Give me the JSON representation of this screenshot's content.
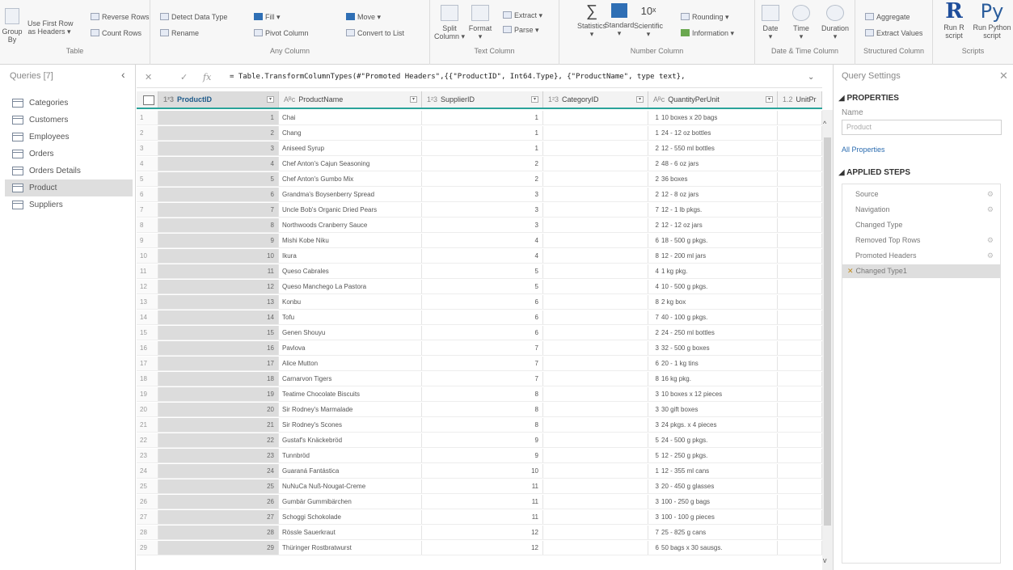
{
  "ribbon": {
    "table": {
      "group_label": "Table",
      "group_by": "Group\nBy",
      "use_first_row": "Use First Row\nas Headers ▾",
      "reverse_rows": "Reverse Rows",
      "count_rows": "Count Rows"
    },
    "any_column": {
      "group_label": "Any Column",
      "detect_data_type": "Detect Data Type",
      "rename": "Rename",
      "fill": "Fill ▾",
      "pivot_column": "Pivot Column",
      "move": "Move ▾",
      "convert_to_list": "Convert to List"
    },
    "text_column": {
      "group_label": "Text Column",
      "split_column": "Split\nColumn ▾",
      "format": "Format\n▾",
      "extract": "Extract ▾",
      "parse": "Parse ▾"
    },
    "number_column": {
      "group_label": "Number Column",
      "statistics": "Statistics\n▾",
      "standard": "Standard\n▾",
      "scientific": "Scientific\n▾",
      "rounding": "Rounding ▾",
      "information": "Information ▾"
    },
    "datetime_column": {
      "group_label": "Date & Time Column",
      "date": "Date\n▾",
      "time": "Time\n▾",
      "duration": "Duration\n▾"
    },
    "structured_column": {
      "group_label": "Structured Column",
      "aggregate": "Aggregate",
      "extract_values": "Extract Values"
    },
    "scripts": {
      "group_label": "Scripts",
      "run_r": "Run R\nscript",
      "run_python": "Run Python\nscript"
    }
  },
  "queries": {
    "header": "Queries [7]",
    "items": [
      "Categories",
      "Customers",
      "Employees",
      "Orders",
      "Orders Details",
      "Product",
      "Suppliers"
    ],
    "active_index": 5
  },
  "formula_bar": {
    "formula": "= Table.TransformColumnTypes(#\"Promoted Headers\",{{\"ProductID\", Int64.Type}, {\"ProductName\", type text},"
  },
  "grid": {
    "columns": [
      {
        "type": "1²3",
        "name": "ProductID"
      },
      {
        "type": "Aᴮc",
        "name": "ProductName"
      },
      {
        "type": "1²3",
        "name": "SupplierID"
      },
      {
        "type": "1²3",
        "name": "CategoryID"
      },
      {
        "type": "Aᴮc",
        "name": "QuantityPerUnit"
      },
      {
        "type": "1.2",
        "name": "UnitPr"
      }
    ],
    "rows": [
      [
        1,
        "Chai",
        1,
        1,
        "10 boxes x 20 bags"
      ],
      [
        2,
        "Chang",
        1,
        1,
        "24 - 12 oz bottles"
      ],
      [
        3,
        "Aniseed Syrup",
        1,
        2,
        "12 - 550 ml bottles"
      ],
      [
        4,
        "Chef Anton's Cajun Seasoning",
        2,
        2,
        "48 - 6 oz jars"
      ],
      [
        5,
        "Chef Anton's Gumbo Mix",
        2,
        2,
        "36 boxes"
      ],
      [
        6,
        "Grandma's Boysenberry Spread",
        3,
        2,
        "12 - 8 oz jars"
      ],
      [
        7,
        "Uncle Bob's Organic Dried Pears",
        3,
        7,
        "12 - 1 lb pkgs."
      ],
      [
        8,
        "Northwoods Cranberry Sauce",
        3,
        2,
        "12 - 12 oz jars"
      ],
      [
        9,
        "Mishi Kobe Niku",
        4,
        6,
        "18 - 500 g pkgs."
      ],
      [
        10,
        "Ikura",
        4,
        8,
        "12 - 200 ml jars"
      ],
      [
        11,
        "Queso Cabrales",
        5,
        4,
        "1 kg pkg."
      ],
      [
        12,
        "Queso Manchego La Pastora",
        5,
        4,
        "10 - 500 g pkgs."
      ],
      [
        13,
        "Konbu",
        6,
        8,
        "2 kg box"
      ],
      [
        14,
        "Tofu",
        6,
        7,
        "40 - 100 g pkgs."
      ],
      [
        15,
        "Genen Shouyu",
        6,
        2,
        "24 - 250 ml bottles"
      ],
      [
        16,
        "Pavlova",
        7,
        3,
        "32 - 500 g boxes"
      ],
      [
        17,
        "Alice Mutton",
        7,
        6,
        "20 - 1 kg tins"
      ],
      [
        18,
        "Carnarvon Tigers",
        7,
        8,
        "16 kg pkg."
      ],
      [
        19,
        "Teatime Chocolate Biscuits",
        8,
        3,
        "10 boxes x 12 pieces"
      ],
      [
        20,
        "Sir Rodney's Marmalade",
        8,
        3,
        "30 gift boxes"
      ],
      [
        21,
        "Sir Rodney's Scones",
        8,
        3,
        "24 pkgs. x 4 pieces"
      ],
      [
        22,
        "Gustaf's Knäckebröd",
        9,
        5,
        "24 - 500 g pkgs."
      ],
      [
        23,
        "Tunnbröd",
        9,
        5,
        "12 - 250 g pkgs."
      ],
      [
        24,
        "Guaraná Fantástica",
        10,
        1,
        "12 - 355 ml cans"
      ],
      [
        25,
        "NuNuCa Nuß-Nougat-Creme",
        11,
        3,
        "20 - 450 g glasses"
      ],
      [
        26,
        "Gumbär Gummibärchen",
        11,
        3,
        "100 - 250 g bags"
      ],
      [
        27,
        "Schoggi Schokolade",
        11,
        3,
        "100 - 100 g pieces"
      ],
      [
        28,
        "Rössle Sauerkraut",
        12,
        7,
        "25 - 825 g cans"
      ],
      [
        29,
        "Thüringer Rostbratwurst",
        12,
        6,
        "50 bags x 30 sausgs."
      ]
    ]
  },
  "settings": {
    "title": "Query Settings",
    "properties_header": "◢ PROPERTIES",
    "name_label": "Name",
    "name_value": "Product",
    "all_properties": "All Properties",
    "applied_steps_header": "◢ APPLIED STEPS",
    "steps": [
      {
        "label": "Source",
        "gear": true
      },
      {
        "label": "Navigation",
        "gear": true
      },
      {
        "label": "Changed Type",
        "gear": false
      },
      {
        "label": "Removed Top Rows",
        "gear": true
      },
      {
        "label": "Promoted Headers",
        "gear": true
      },
      {
        "label": "Changed Type1",
        "gear": false
      }
    ],
    "active_step": 5
  },
  "colors": {
    "accent_teal": "#2aa39a",
    "selected_gray": "#dcdcdc",
    "link_blue": "#2b6cb0"
  }
}
